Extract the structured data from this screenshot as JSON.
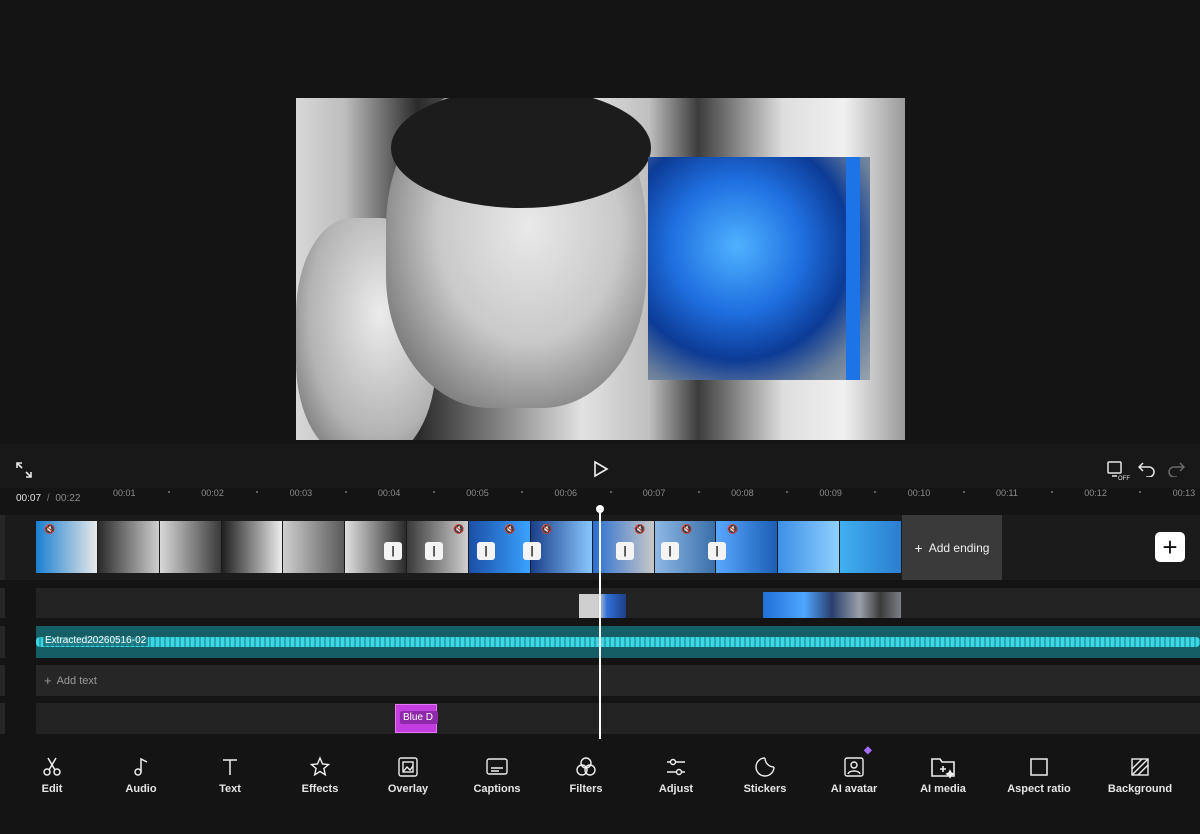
{
  "preview": {
    "image": "preview-frame-grayscale-portrait",
    "overlay_image": "blue-rose-overlay"
  },
  "controls": {
    "fullscreen_icon": "fullscreen-icon",
    "play_icon": "play-icon",
    "screen_off_label": "OFF",
    "undo_icon": "undo-icon",
    "redo_icon": "redo-icon"
  },
  "time": {
    "current": "00:07",
    "separator": "/",
    "total": "00:22"
  },
  "ruler": [
    "00:01",
    "00:02",
    "00:03",
    "00:04",
    "00:05",
    "00:06",
    "00:07",
    "00:08",
    "00:09",
    "00:10",
    "00:11",
    "00:12",
    "00:13"
  ],
  "timeline": {
    "add_ending": "Add ending",
    "add_clip_symbol": "+",
    "audio_name": "Extracted20260516-02",
    "add_text": "Add text",
    "effect_name": "Blue D"
  },
  "toolbar": [
    {
      "label": "Edit",
      "icon": "scissors-icon"
    },
    {
      "label": "Audio",
      "icon": "music-note-icon"
    },
    {
      "label": "Text",
      "icon": "text-icon"
    },
    {
      "label": "Effects",
      "icon": "sparkle-star-icon"
    },
    {
      "label": "Overlay",
      "icon": "overlay-icon"
    },
    {
      "label": "Captions",
      "icon": "captions-icon"
    },
    {
      "label": "Filters",
      "icon": "filters-icon"
    },
    {
      "label": "Adjust",
      "icon": "sliders-icon"
    },
    {
      "label": "Stickers",
      "icon": "sticker-icon"
    },
    {
      "label": "AI avatar",
      "icon": "ai-avatar-icon"
    },
    {
      "label": "AI media",
      "icon": "ai-media-icon"
    },
    {
      "label": "Aspect ratio",
      "icon": "aspect-ratio-icon"
    },
    {
      "label": "Background",
      "icon": "background-icon"
    }
  ],
  "colors": {
    "accent_audio": "#155e66",
    "effect": "#c33de0",
    "premium_badge": "#a66bff"
  }
}
